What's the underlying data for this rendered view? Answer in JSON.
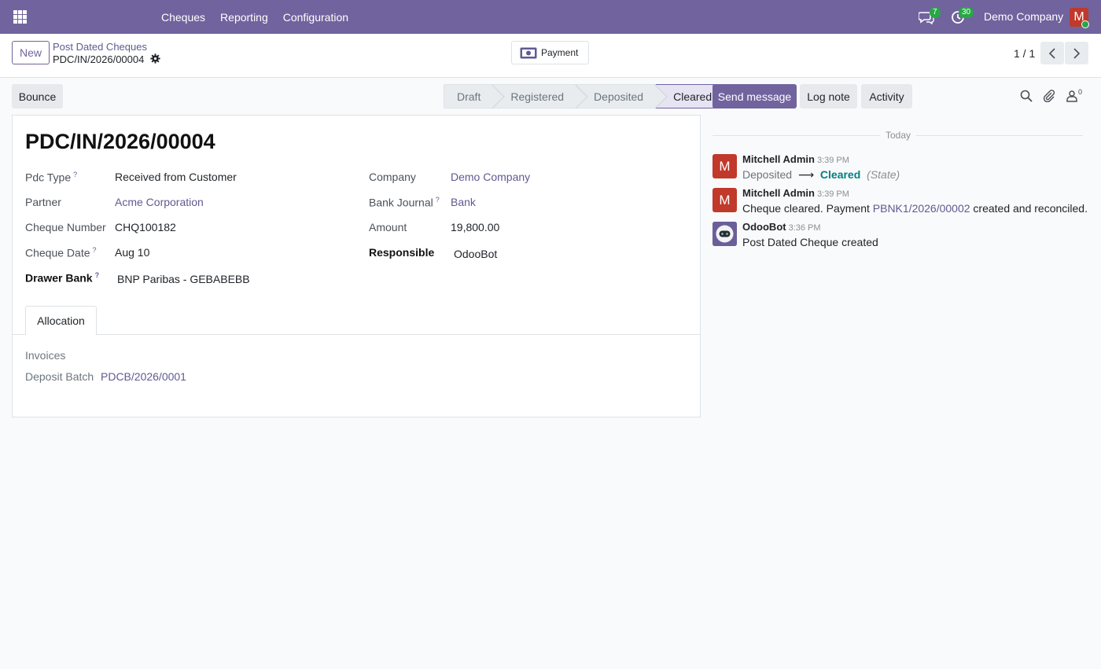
{
  "navbar": {
    "menu": [
      "Cheques",
      "Reporting",
      "Configuration"
    ],
    "messages_count": "7",
    "activities_count": "30",
    "company": "Demo Company",
    "user_initial": "M",
    "accent_color": "#71639e"
  },
  "control_panel": {
    "new_label": "New",
    "breadcrumb_parent": "Post Dated Cheques",
    "breadcrumb_current": "PDC/IN/2026/00004",
    "payment_label": "Payment",
    "pager": "1 / 1"
  },
  "actions": {
    "bounce_label": "Bounce"
  },
  "statusbar": {
    "stages": [
      "Draft",
      "Registered",
      "Deposited",
      "Cleared"
    ],
    "active": "Cleared"
  },
  "form": {
    "title": "PDC/IN/2026/00004",
    "labels": {
      "pdc_type": "Pdc Type",
      "partner": "Partner",
      "cheque_number": "Cheque Number",
      "cheque_date": "Cheque Date",
      "drawer_bank": "Drawer Bank",
      "company": "Company",
      "bank_journal": "Bank Journal",
      "amount": "Amount",
      "responsible": "Responsible",
      "help_mark": "?"
    },
    "values": {
      "pdc_type": "Received from Customer",
      "partner": "Acme Corporation",
      "cheque_number": "CHQ100182",
      "cheque_date": "Aug 10",
      "drawer_bank": "BNP Paribas - GEBABEBB",
      "company": "Demo Company",
      "bank_journal": "Bank",
      "amount": "19,800.00",
      "responsible": "OdooBot"
    },
    "tab": "Allocation",
    "allocation": {
      "invoices_label": "Invoices",
      "deposit_batch_label": "Deposit Batch",
      "deposit_batch_value": "PDCB/2026/0001"
    }
  },
  "chatter": {
    "send_message": "Send message",
    "log_note": "Log note",
    "activity": "Activity",
    "followers_count": "0",
    "date_separator": "Today",
    "messages": [
      {
        "author": "Mitchell Admin",
        "time": "3:39 PM",
        "initial": "M",
        "old_value": "Deposited",
        "arrow": "⟶",
        "new_value": "Cleared",
        "field": "(State)"
      },
      {
        "author": "Mitchell Admin",
        "time": "3:39 PM",
        "initial": "M",
        "text_before": "Cheque cleared. Payment ",
        "link": "PBNK1/2026/00002",
        "text_after": " created and reconciled."
      },
      {
        "author": "OdooBot",
        "time": "3:36 PM",
        "text": "Post Dated Cheque created"
      }
    ]
  }
}
